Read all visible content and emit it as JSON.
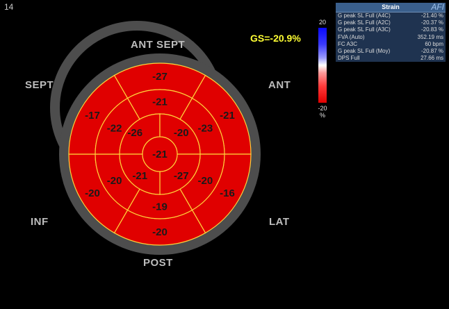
{
  "frame_number": "14",
  "gs_label": "GS=-20.9%",
  "wall_labels": {
    "ant_sept": "ANT SEPT",
    "sept": "SEPT",
    "ant": "ANT",
    "inf": "INF",
    "lat": "LAT",
    "post": "POST"
  },
  "segments": {
    "basal": [
      "-27",
      "-21",
      "-16",
      "-20",
      "-20",
      "-17"
    ],
    "mid": [
      "-21",
      "-23",
      "-20",
      "-19",
      "-20",
      "-22"
    ],
    "apical": [
      "-26",
      "-20",
      "-27",
      "-21"
    ],
    "apex": "-21"
  },
  "scale": {
    "max": "20",
    "min": "-20",
    "unit": "%"
  },
  "panel": {
    "title": "Strain",
    "brand": "AFI",
    "rows": [
      {
        "label": "G peak SL Full (A4C)",
        "value": "-21.40 %"
      },
      {
        "label": "G peak SL Full (A2C)",
        "value": "-20.37 %"
      },
      {
        "label": "G peak SL Full (A3C)",
        "value": "-20.83 %"
      },
      {
        "label": "FVA (Auto)",
        "value": "352.19 ms"
      },
      {
        "label": "FC A3C",
        "value": "60 bpm"
      },
      {
        "label": "G peak SL Full (Moy)",
        "value": "-20.87 %"
      },
      {
        "label": "DPS Full",
        "value": "27.66 ms"
      }
    ]
  },
  "colors": {
    "segment_fill": "#e00000",
    "segment_line": "#ffd23a",
    "ring": "#4d4d4d",
    "gs_text": "#ffff33",
    "panel_bg": "#1f3350"
  }
}
